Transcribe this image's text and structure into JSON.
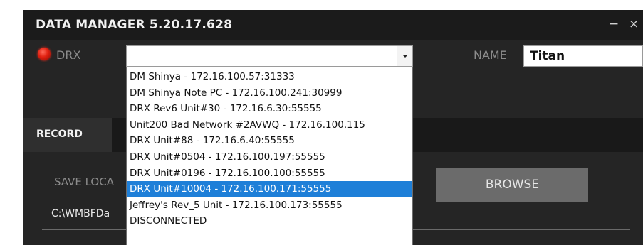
{
  "window": {
    "title": "DATA MANAGER  5.20.17.628",
    "minimize_glyph": "−",
    "close_glyph": "×"
  },
  "connection": {
    "status_color": "#e02010",
    "label": "DRX",
    "combo_value": "",
    "dropdown_open": true,
    "selected_index": 7,
    "options": [
      "DM Shinya - 172.16.100.57:31333",
      "DM Shinya Note PC - 172.16.100.241:30999",
      "DRX Rev6 Unit#30 - 172.16.6.30:55555",
      "Unit200 Bad Network #2AVWQ - 172.16.100.115",
      "DRX Unit#88 - 172.16.6.40:55555",
      "DRX Unit#0504 - 172.16.100.197:55555",
      "DRX Unit#0196 - 172.16.100.100:55555",
      "DRX Unit#10004 - 172.16.100.171:55555",
      "Jeffrey's Rev_5 Unit - 172.16.100.173:55555",
      "DISCONNECTED"
    ]
  },
  "name_field": {
    "label": "NAME",
    "value": "Titan"
  },
  "tabs": {
    "record": "RECORD"
  },
  "record": {
    "save_location_label": "SAVE LOCA",
    "path_value": "C:\\WMBFDa",
    "browse_label": "BROWSE"
  },
  "colors": {
    "accent_selected": "#1e7fd8",
    "background": "#252525",
    "button": "#6b6b6b"
  }
}
